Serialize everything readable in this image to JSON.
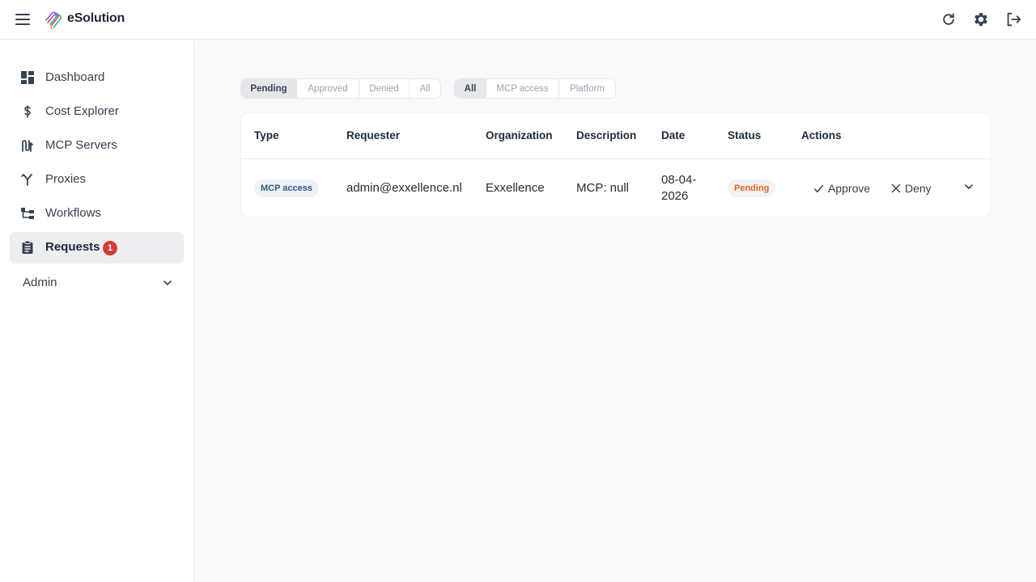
{
  "app": {
    "brand": "eSolution"
  },
  "header": {
    "icons": [
      "menu-icon",
      "refresh-icon",
      "gear-icon",
      "logout-icon"
    ]
  },
  "sidebar": {
    "items": [
      {
        "label": "Dashboard",
        "icon": "dashboard-icon"
      },
      {
        "label": "Cost Explorer",
        "icon": "dollar-icon"
      },
      {
        "label": "MCP Servers",
        "icon": "mcp-servers-icon"
      },
      {
        "label": "Proxies",
        "icon": "proxies-icon"
      },
      {
        "label": "Workflows",
        "icon": "workflows-icon"
      },
      {
        "label": "Requests",
        "icon": "clipboard-icon",
        "badge": "1",
        "active": true
      }
    ],
    "admin_label": "Admin"
  },
  "filters": {
    "status": [
      "Pending",
      "Approved",
      "Denied",
      "All"
    ],
    "status_selected": "Pending",
    "type": [
      "All",
      "MCP access",
      "Platform"
    ],
    "type_selected": "All"
  },
  "table": {
    "headers": [
      "Type",
      "Requester",
      "Organization",
      "Description",
      "Date",
      "Status",
      "Actions"
    ],
    "rows": [
      {
        "type": "MCP access",
        "requester": "admin@exxellence.nl",
        "organization": "Exxellence",
        "description": "MCP: null",
        "date_line1": "08-04-",
        "date_line2": "2026",
        "status": "Pending",
        "approve_label": "Approve",
        "deny_label": "Deny"
      }
    ]
  },
  "colors": {
    "badge": "#d83a3a",
    "status_pending": "#e0662b",
    "type_chip_text": "#2f5a86",
    "active_nav_bg": "#eceef2"
  }
}
